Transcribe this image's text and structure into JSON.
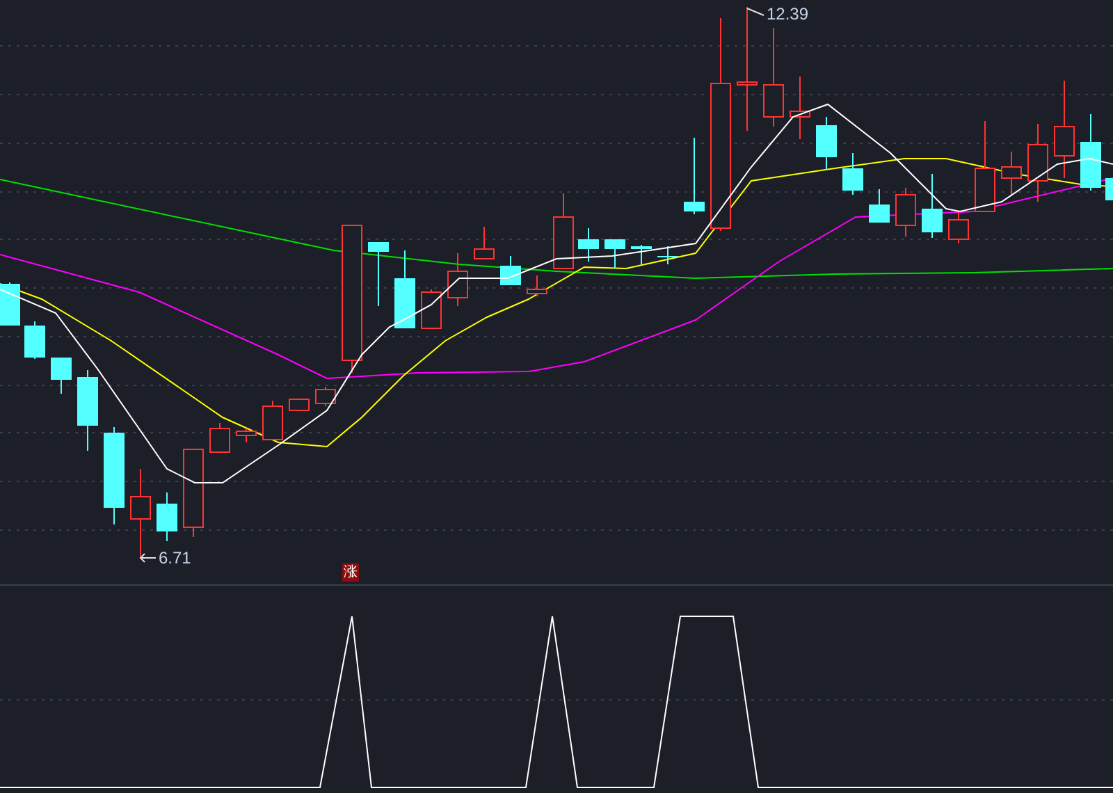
{
  "price_chart": {
    "high_label": "12.39",
    "low_label": "6.71",
    "signal_badge": "涨"
  }
}
